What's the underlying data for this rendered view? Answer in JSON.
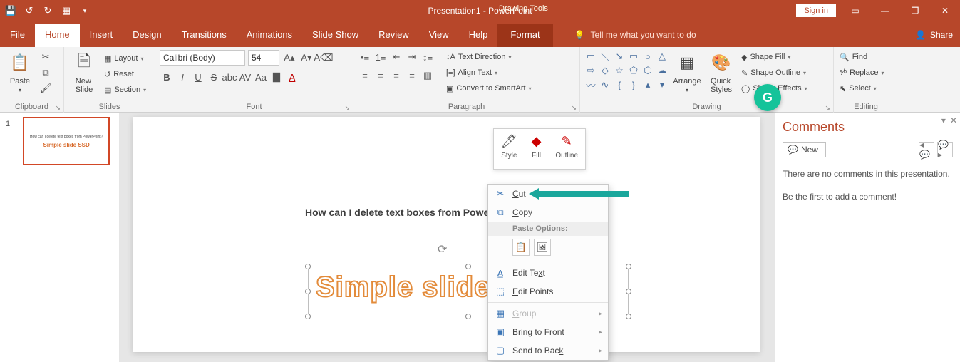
{
  "titlebar": {
    "title": "Presentation1 - PowerPoint",
    "contextual_tool": "Drawing Tools",
    "signin": "Sign in"
  },
  "tabs": {
    "file": "File",
    "home": "Home",
    "insert": "Insert",
    "design": "Design",
    "transitions": "Transitions",
    "animations": "Animations",
    "slideshow": "Slide Show",
    "review": "Review",
    "view": "View",
    "help": "Help",
    "format": "Format",
    "tellme": "Tell me what you want to do",
    "share": "Share"
  },
  "ribbon": {
    "clipboard": {
      "label": "Clipboard",
      "paste": "Paste"
    },
    "slides": {
      "label": "Slides",
      "newslide": "New\nSlide",
      "layout": "Layout",
      "reset": "Reset",
      "section": "Section"
    },
    "font": {
      "label": "Font",
      "name": "Calibri (Body)",
      "size": "54"
    },
    "paragraph": {
      "label": "Paragraph",
      "textdir": "Text Direction",
      "align": "Align Text",
      "smartart": "Convert to SmartArt"
    },
    "drawing": {
      "label": "Drawing",
      "arrange": "Arrange",
      "quick": "Quick\nStyles",
      "fill": "Shape Fill",
      "outline": "Shape Outline",
      "effects": "Shape Effects"
    },
    "editing": {
      "label": "Editing",
      "find": "Find",
      "replace": "Replace",
      "select": "Select"
    }
  },
  "thumb": {
    "num": "1",
    "line1": "How can I delete text boxes from PowerPoint?",
    "line2": "Simple slide SSD"
  },
  "float": {
    "style": "Style",
    "fill": "Fill",
    "outline": "Outline"
  },
  "slide": {
    "bodytext": "How can I delete text boxes from Powe",
    "wordart": "Simple slide"
  },
  "ctx": {
    "cut": "Cut",
    "copy": "Copy",
    "paste_opts": "Paste Options:",
    "edit_text": "Edit Text",
    "edit_points": "Edit Points",
    "group": "Group",
    "bring_front": "Bring to Front",
    "send_back": "Send to Back"
  },
  "comments": {
    "title": "Comments",
    "new": "New",
    "empty1": "There are no comments in this presentation.",
    "empty2": "Be the first to add a comment!"
  }
}
